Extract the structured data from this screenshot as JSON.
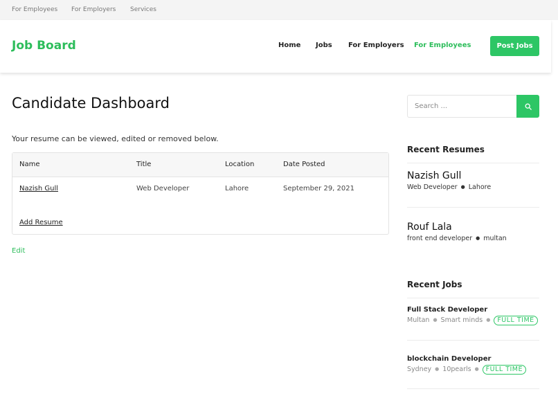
{
  "topbar": {
    "links": [
      "For Employees",
      "For Employers",
      "Services"
    ]
  },
  "header": {
    "logo": "Job Board",
    "nav": [
      "Home",
      "Jobs",
      "For Employers",
      "For Employees"
    ],
    "post_label": "Post Jobs"
  },
  "colors": {
    "accent": "#2dc665"
  },
  "main": {
    "title": "Candidate Dashboard",
    "intro": "Your resume can be viewed, edited or removed below.",
    "table": {
      "headers": [
        "Name",
        "Title",
        "Location",
        "Date Posted"
      ],
      "rows": [
        {
          "name": "Nazish Gull",
          "title": "Web Developer",
          "location": "Lahore",
          "date": "September 29, 2021"
        }
      ]
    },
    "add_resume": "Add Resume",
    "edit": "Edit"
  },
  "sidebar": {
    "search_placeholder": "Search ...",
    "search_icon": "search-icon",
    "recent_resumes_title": "Recent Resumes",
    "resumes": [
      {
        "name": "Nazish Gull",
        "title": "Web Developer",
        "location": "Lahore"
      },
      {
        "name": "Rouf Lala",
        "title": "front end developer",
        "location": "multan"
      }
    ],
    "recent_jobs_title": "Recent Jobs",
    "jobs": [
      {
        "title": "Full Stack Developer",
        "location": "Multan",
        "company": "Smart minds",
        "type": "FULL TIME"
      },
      {
        "title": "blockchain Developer",
        "location": "Sydney",
        "company": "10pearls",
        "type": "FULL TIME"
      }
    ]
  }
}
